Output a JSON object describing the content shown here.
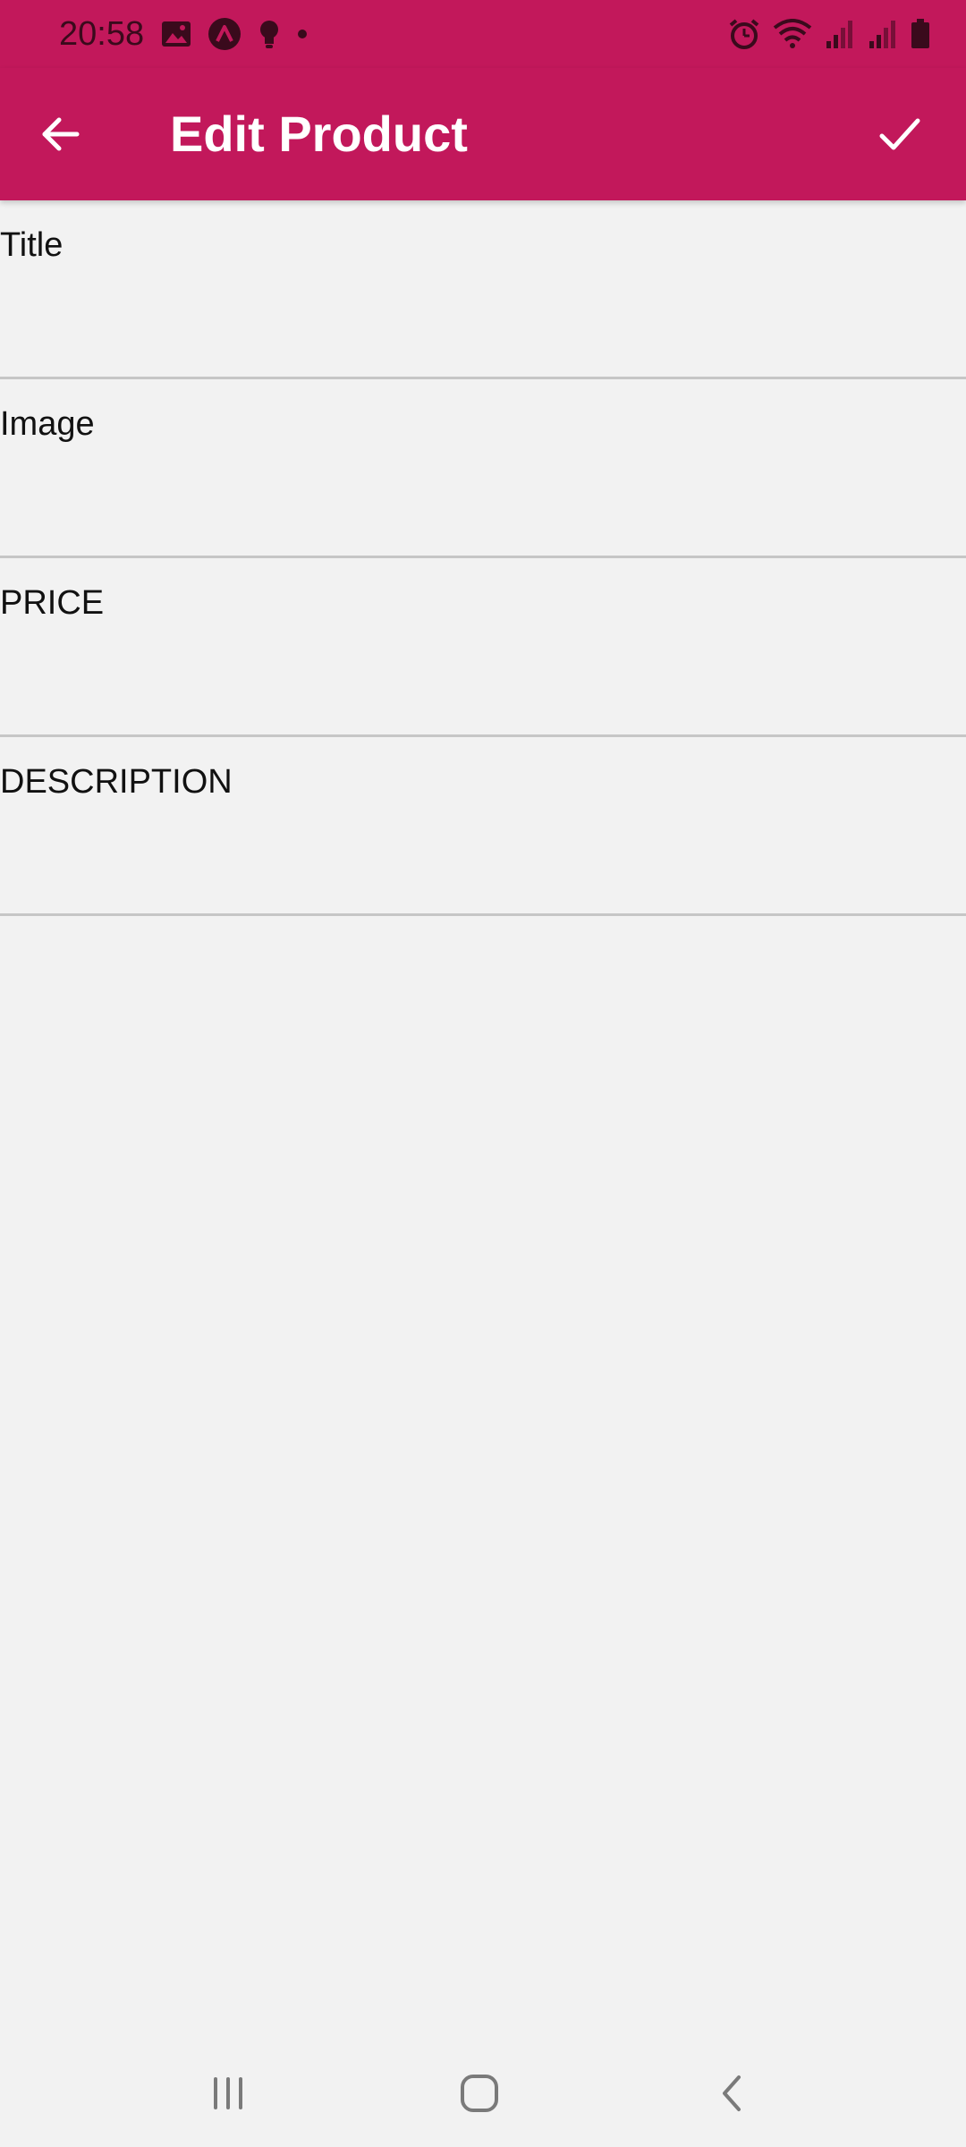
{
  "status_bar": {
    "time": "20:58"
  },
  "app_bar": {
    "title": "Edit Product",
    "background_color": "#c2185b"
  },
  "form": {
    "fields": [
      {
        "label": "Title",
        "value": ""
      },
      {
        "label": "Image",
        "value": ""
      },
      {
        "label": "PRICE",
        "value": ""
      },
      {
        "label": "DESCRIPTION",
        "value": ""
      }
    ]
  },
  "icons": {
    "back": "arrow-left-icon",
    "save": "check-icon",
    "nav_recents": "recents-icon",
    "nav_home": "home-icon",
    "nav_back": "nav-back-icon"
  }
}
